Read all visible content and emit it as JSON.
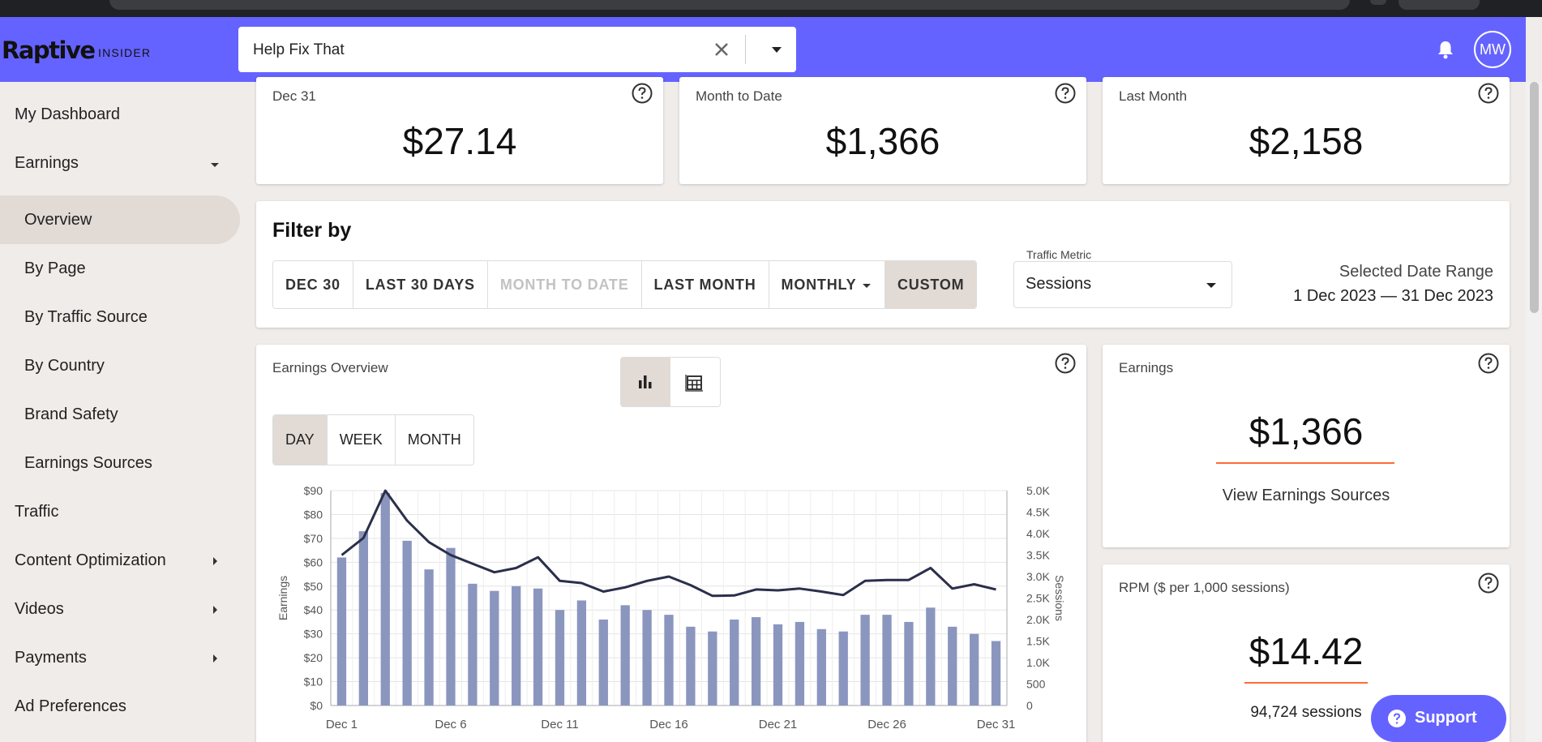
{
  "header": {
    "logo": "Raptive",
    "logo_sub": "INSIDER",
    "site_value": "Help Fix That",
    "avatar": "MW"
  },
  "sidebar": {
    "items": [
      {
        "label": "My Dashboard"
      },
      {
        "label": "Earnings"
      },
      {
        "label": "Overview"
      },
      {
        "label": "By Page"
      },
      {
        "label": "By Traffic Source"
      },
      {
        "label": "By Country"
      },
      {
        "label": "Brand Safety"
      },
      {
        "label": "Earnings Sources"
      },
      {
        "label": "Traffic"
      },
      {
        "label": "Content Optimization"
      },
      {
        "label": "Videos"
      },
      {
        "label": "Payments"
      },
      {
        "label": "Ad Preferences"
      }
    ]
  },
  "stats": [
    {
      "label": "Dec 31",
      "value": "$27.14"
    },
    {
      "label": "Month to Date",
      "value": "$1,366"
    },
    {
      "label": "Last Month",
      "value": "$2,158"
    }
  ],
  "filter": {
    "title": "Filter by",
    "options": [
      "DEC 30",
      "LAST 30 DAYS",
      "MONTH TO DATE",
      "LAST MONTH",
      "MONTHLY",
      "CUSTOM"
    ],
    "selected": "CUSTOM",
    "disabled": "MONTH TO DATE",
    "metric_label": "Traffic Metric",
    "metric_value": "Sessions",
    "range_label": "Selected Date Range",
    "range_value": "1 Dec 2023 — 31 Dec 2023"
  },
  "overview": {
    "title": "Earnings Overview",
    "granularity": [
      "DAY",
      "WEEK",
      "MONTH"
    ],
    "selected_granularity": "DAY",
    "view_toggle": [
      "bar-chart-icon",
      "table-icon"
    ]
  },
  "earnings_card": {
    "label": "Earnings",
    "value": "$1,366",
    "link": "View Earnings Sources"
  },
  "rpm_card": {
    "label": "RPM ($ per 1,000 sessions)",
    "value": "$14.42",
    "sessions": "94,724 sessions"
  },
  "support": {
    "label": "Support"
  },
  "colors": {
    "accent": "#6563ff",
    "bar": "#8b96bf",
    "line": "#2a2f4a",
    "highlight": "#ff6b35",
    "selected": "#e2dad5"
  },
  "chart_data": {
    "type": "bar",
    "categories": [
      "Dec 1",
      "Dec 2",
      "Dec 3",
      "Dec 4",
      "Dec 5",
      "Dec 6",
      "Dec 7",
      "Dec 8",
      "Dec 9",
      "Dec 10",
      "Dec 11",
      "Dec 12",
      "Dec 13",
      "Dec 14",
      "Dec 15",
      "Dec 16",
      "Dec 17",
      "Dec 18",
      "Dec 19",
      "Dec 20",
      "Dec 21",
      "Dec 22",
      "Dec 23",
      "Dec 24",
      "Dec 25",
      "Dec 26",
      "Dec 27",
      "Dec 28",
      "Dec 29",
      "Dec 30",
      "Dec 31"
    ],
    "x_tick_labels": [
      "Dec 1",
      "Dec 6",
      "Dec 11",
      "Dec 16",
      "Dec 21",
      "Dec 26",
      "Dec 31"
    ],
    "series": [
      {
        "name": "Earnings",
        "axis": "left",
        "type": "bar",
        "values": [
          62,
          73,
          89,
          69,
          57,
          66,
          51,
          48,
          50,
          49,
          40,
          44,
          36,
          42,
          40,
          38,
          33,
          31,
          36,
          37,
          34,
          35,
          32,
          31,
          38,
          38,
          35,
          41,
          33,
          30,
          27
        ]
      },
      {
        "name": "Sessions",
        "axis": "right",
        "type": "line",
        "values": [
          3500,
          3900,
          5000,
          4300,
          3800,
          3500,
          3300,
          3100,
          3200,
          3450,
          2900,
          2850,
          2650,
          2750,
          2900,
          3000,
          2800,
          2550,
          2560,
          2700,
          2680,
          2720,
          2650,
          2570,
          2900,
          2920,
          2920,
          3200,
          2720,
          2820,
          2700
        ]
      }
    ],
    "ylabel": "Earnings",
    "y2label": "Sessions",
    "ylim": [
      0,
      90
    ],
    "y2lim": [
      0,
      5000
    ],
    "y_ticks": [
      "$0",
      "$10",
      "$20",
      "$30",
      "$40",
      "$50",
      "$60",
      "$70",
      "$80",
      "$90"
    ],
    "y2_ticks": [
      "0",
      "500",
      "1.0K",
      "1.5K",
      "2.0K",
      "2.5K",
      "3.0K",
      "3.5K",
      "4.0K",
      "4.5K",
      "5.0K"
    ],
    "grid": true
  }
}
